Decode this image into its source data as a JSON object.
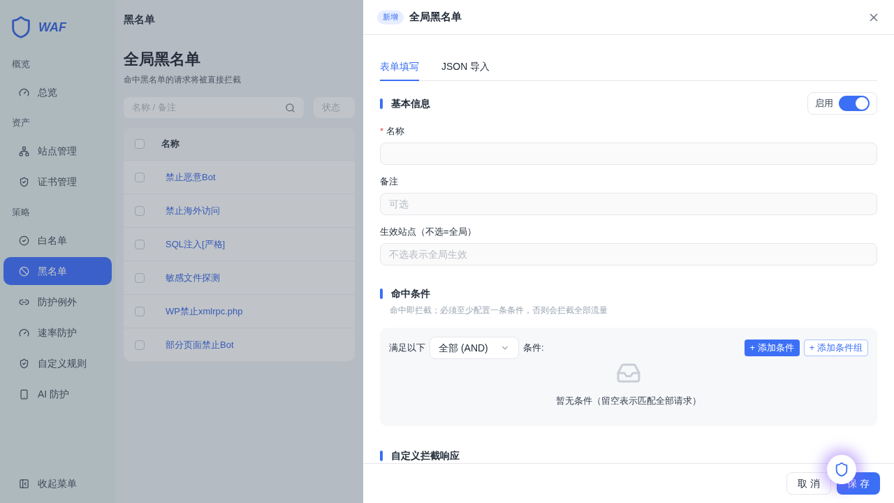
{
  "sidebar": {
    "logo_text": "WAF",
    "groups": [
      {
        "label": "概览",
        "items": [
          {
            "label": "总览",
            "selected": false
          }
        ]
      },
      {
        "label": "资产",
        "items": [
          {
            "label": "站点管理",
            "selected": false
          },
          {
            "label": "证书管理",
            "selected": false
          }
        ]
      },
      {
        "label": "策略",
        "items": [
          {
            "label": "白名单",
            "selected": false
          },
          {
            "label": "黑名单",
            "selected": true
          },
          {
            "label": "防护例外",
            "selected": false
          },
          {
            "label": "速率防护",
            "selected": false
          },
          {
            "label": "自定义规则",
            "selected": false
          },
          {
            "label": "AI 防护",
            "selected": false
          }
        ]
      }
    ],
    "collapse": "收起菜单"
  },
  "page": {
    "breadcrumb": "黑名单",
    "title": "全局黑名单",
    "subtitle": "命中黑名单的请求将被直接拦截",
    "search": {
      "placeholder": "名称 / 备注"
    },
    "status_filter": {
      "placeholder": "状态"
    },
    "table": {
      "select_all": {
        "checked": false
      },
      "columns": [
        "名称"
      ],
      "rows": [
        {
          "name": "禁止恶意Bot",
          "checked": false
        },
        {
          "name": "禁止海外访问",
          "checked": false
        },
        {
          "name": "SQL注入[严格]",
          "checked": false
        },
        {
          "name": "敏感文件探测",
          "checked": false
        },
        {
          "name": "WP禁止xmlrpc.php",
          "checked": false
        },
        {
          "name": "部分页面禁止Bot",
          "checked": false
        }
      ]
    }
  },
  "drawer": {
    "badge": "新增",
    "title": "全局黑名单",
    "tabs": [
      {
        "label": "表单填写",
        "selected": true
      },
      {
        "label": "JSON 导入",
        "selected": false
      }
    ],
    "basic": {
      "title": "基本信息",
      "enable_label": "启用",
      "enabled": true,
      "fields": [
        {
          "label": "名称",
          "required": true,
          "required_mark": "*"
        },
        {
          "label": "备注",
          "required": false,
          "placeholder": "可选"
        },
        {
          "label": "生效站点（不选=全局）",
          "required": false,
          "placeholder": "不选表示全局生效"
        }
      ]
    },
    "conditions": {
      "title": "命中条件",
      "hint": "命中即拦截；必须至少配置一条条件，否则会拦截全部流量",
      "prefix": "满足以下",
      "mode": "全部 (AND)",
      "suffix": "条件:",
      "add_condition": "+ 添加条件",
      "add_group": "+ 添加条件组",
      "empty": "暂无条件（留空表示匹配全部请求）"
    },
    "next_section": "自定义拦截响应",
    "footer": {
      "cancel": "取 消",
      "save": "保 存"
    }
  }
}
